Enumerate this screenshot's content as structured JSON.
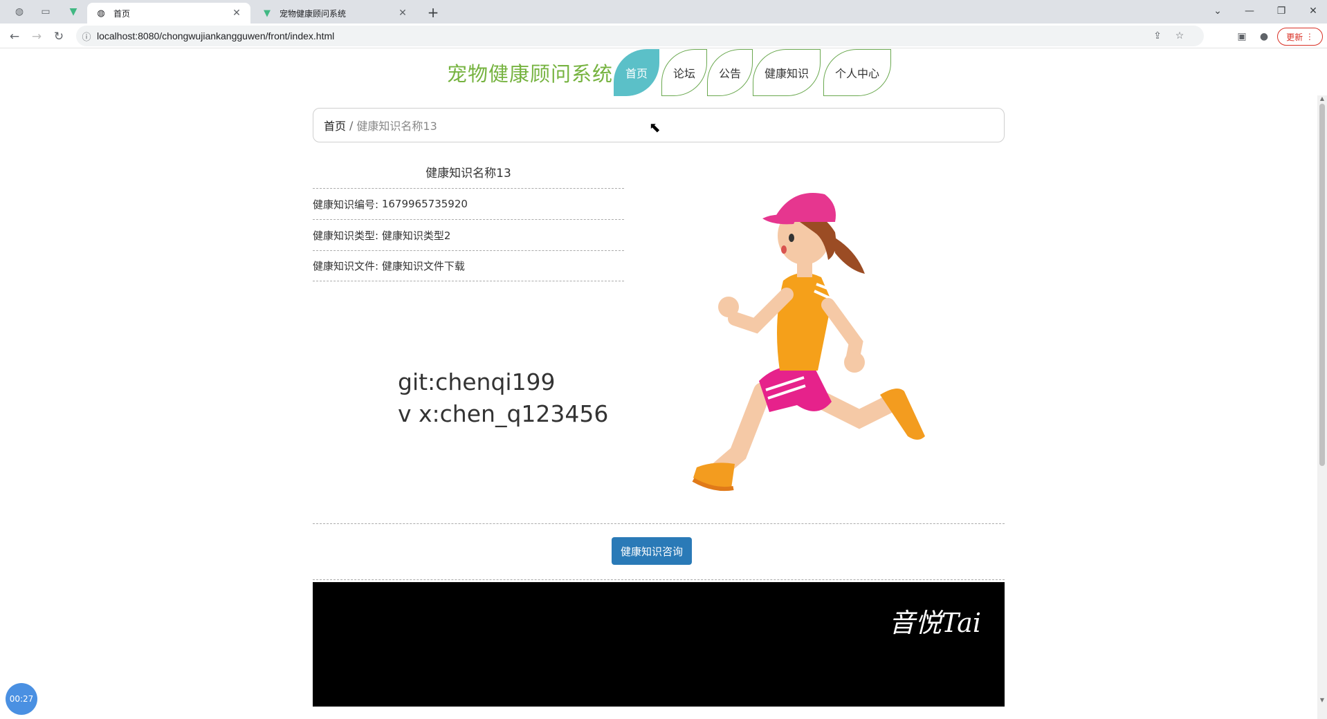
{
  "browser": {
    "tabs": [
      {
        "title": "首页",
        "icon": "globe-icon",
        "active": true
      },
      {
        "title": "宠物健康顾问系统",
        "icon": "vue-logo-icon",
        "active": false
      }
    ],
    "url": "localhost:8080/chongwujiankangguwen/front/index.html",
    "update_label": "更新"
  },
  "site": {
    "title": "宠物健康顾问系统",
    "nav": [
      "首页",
      "论坛",
      "公告",
      "健康知识",
      "个人中心"
    ],
    "active_nav": "首页"
  },
  "breadcrumb": {
    "home": "首页",
    "separator": "/",
    "current": "健康知识名称13"
  },
  "detail": {
    "title": "健康知识名称13",
    "rows": [
      {
        "label": "健康知识编号:",
        "value": "1679965735920"
      },
      {
        "label": "健康知识类型:",
        "value": "健康知识类型2"
      },
      {
        "label": "健康知识文件:",
        "value": "健康知识文件下载"
      }
    ]
  },
  "overlay_text": {
    "line1": "git:chenqi199",
    "line2": "v x:chen_q123456"
  },
  "consult_button": "健康知识咨询",
  "video": {
    "logo_text": "音悦Tai"
  },
  "timer": "00:27",
  "colors": {
    "brand_green": "#76b340",
    "active_nav": "#5bc0c8",
    "button_blue": "#2a7ab7"
  }
}
